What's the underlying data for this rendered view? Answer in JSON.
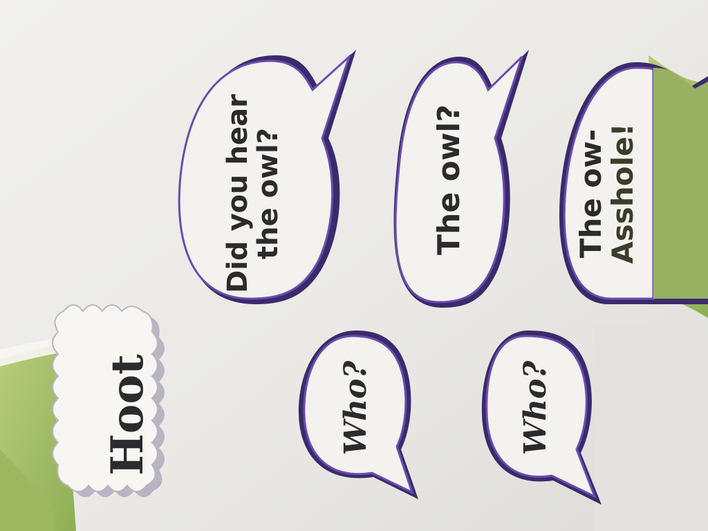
{
  "hoot_card": {
    "text": "Hoot"
  },
  "bubbles": [
    {
      "line1": "Did you hear",
      "line2": "the owl?"
    },
    {
      "line1": "The owl?"
    },
    {
      "line1": "The ow-",
      "line2": "Asshole!"
    },
    {
      "line1": "Who?"
    },
    {
      "line1": "Who?"
    }
  ],
  "colors": {
    "paper": "#ecebe8",
    "bubble_fill": "#f3f2ee",
    "bubble_outline": "#5a3f9a",
    "shadow_purple": "#3b2a6b",
    "green": "#a9c46e",
    "text": "#2b2a2c"
  }
}
